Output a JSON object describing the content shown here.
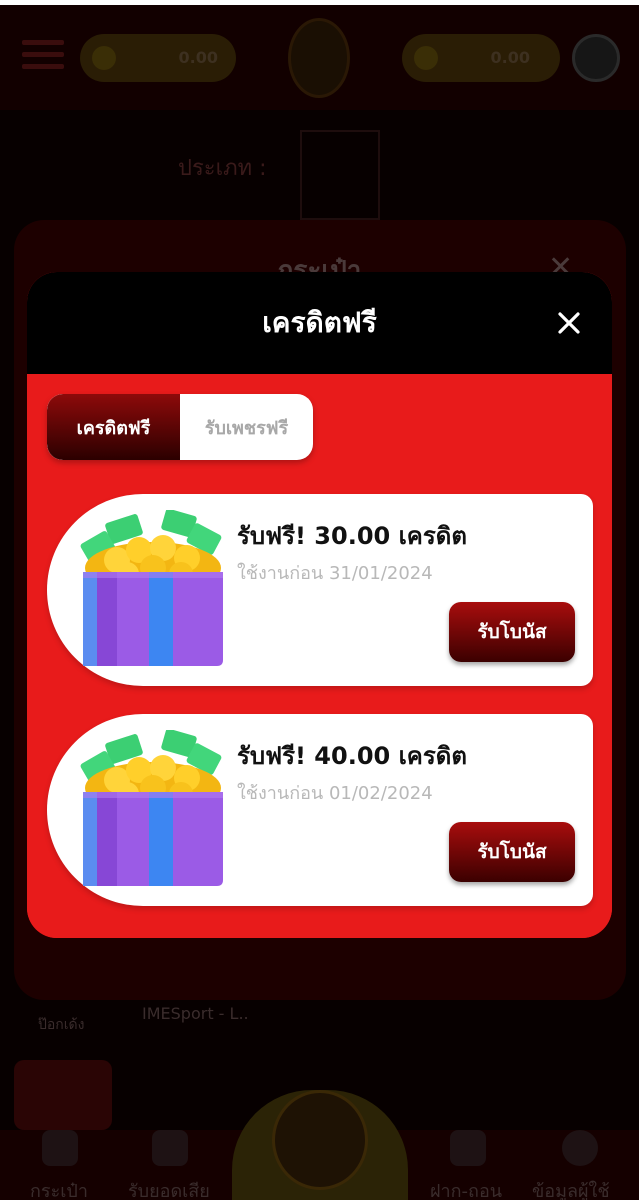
{
  "background": {
    "type_label": "ประเภท :",
    "top_balance_left": "0.00",
    "top_balance_right": "0.00",
    "wallet_title": "กระเป๋า",
    "bottom_label_1": "ป๊อกเด้ง",
    "bottom_label_2": "IMESport - L..",
    "nav": [
      "กระเป๋า",
      "รับยอดเสีย",
      "ฝาก-ถอน",
      "ข้อมูลผู้ใช้"
    ]
  },
  "modal": {
    "title": "เครดิตฟรี",
    "close_icon": "close-icon",
    "tabs": [
      {
        "label": "เครดิตฟรี",
        "active": true
      },
      {
        "label": "รับเพชรฟรี",
        "active": false
      }
    ],
    "bonuses": [
      {
        "title": "รับฟรี! 30.00 เครดิต",
        "expiry": "ใช้งานก่อน 31/01/2024",
        "button": "รับโบนัส",
        "icon": "gift-box-icon"
      },
      {
        "title": "รับฟรี! 40.00 เครดิต",
        "expiry": "ใช้งานก่อน 01/02/2024",
        "button": "รับโบนัส",
        "icon": "gift-box-icon"
      }
    ]
  },
  "colors": {
    "modal_body": "#e81b1b",
    "header": "#000000",
    "button_dark_red": "#3b0000",
    "muted_text": "#b8b8b8"
  }
}
